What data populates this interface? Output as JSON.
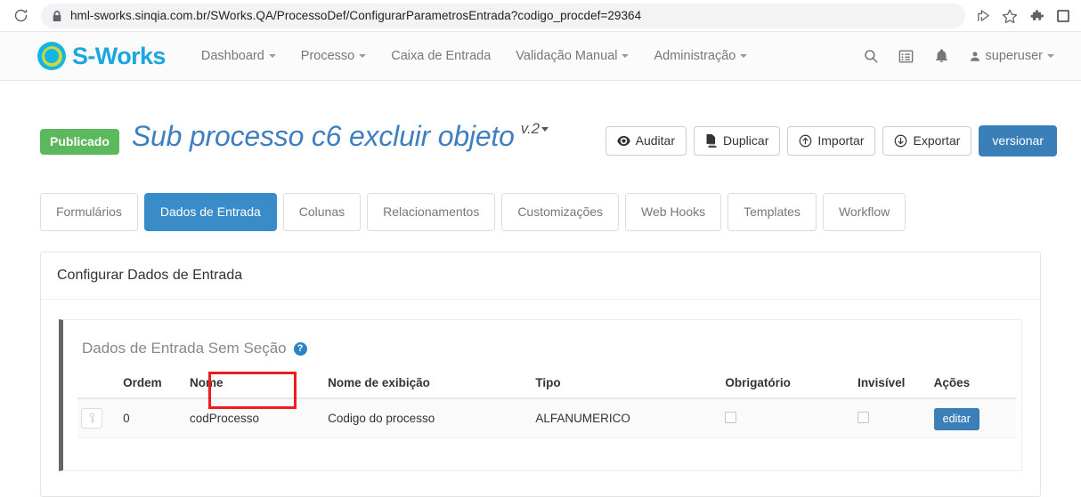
{
  "browser": {
    "url": "hml-sworks.sinqia.com.br/SWorks.QA/ProcessoDef/ConfigurarParametrosEntrada?codigo_procdef=29364",
    "reload_icon": "reload-icon",
    "lock_icon": "lock-icon",
    "toolbar_icons": [
      "share-icon",
      "star-icon",
      "extensions-puzzle-icon",
      "profile-square-icon"
    ]
  },
  "navbar": {
    "brand": "S-Works",
    "items": [
      {
        "label": "Dashboard",
        "has_caret": true
      },
      {
        "label": "Processo",
        "has_caret": true
      },
      {
        "label": "Caixa de Entrada",
        "has_caret": false
      },
      {
        "label": "Validação Manual",
        "has_caret": true
      },
      {
        "label": "Administração",
        "has_caret": true
      }
    ],
    "right_icons": [
      "search-icon",
      "list-icon",
      "bell-icon"
    ],
    "user": "superuser"
  },
  "header": {
    "status_badge": "Publicado",
    "title": "Sub processo c6 excluir objeto",
    "version": "v.2",
    "actions": [
      {
        "label": "Auditar",
        "icon": "eye-icon"
      },
      {
        "label": "Duplicar",
        "icon": "copy-icon"
      },
      {
        "label": "Importar",
        "icon": "arrow-up-circle-icon"
      },
      {
        "label": "Exportar",
        "icon": "arrow-down-circle-icon"
      }
    ],
    "primary_action": "versionar"
  },
  "tabs": [
    {
      "label": "Formulários",
      "active": false
    },
    {
      "label": "Dados de Entrada",
      "active": true
    },
    {
      "label": "Colunas",
      "active": false
    },
    {
      "label": "Relacionamentos",
      "active": false
    },
    {
      "label": "Customizações",
      "active": false
    },
    {
      "label": "Web Hooks",
      "active": false
    },
    {
      "label": "Templates",
      "active": false
    },
    {
      "label": "Workflow",
      "active": false
    }
  ],
  "panel": {
    "title": "Configurar Dados de Entrada",
    "section_title": "Dados de Entrada Sem Seção",
    "help_icon_label": "?"
  },
  "table": {
    "headers": [
      "Ordem",
      "Nome",
      "Nome de exibição",
      "Tipo",
      "Obrigatório",
      "Invisível",
      "Ações"
    ],
    "rows": [
      {
        "handle_icon": "key-icon",
        "ordem": "0",
        "nome": "codProcesso",
        "nome_exibicao": "Codigo do processo",
        "tipo": "ALFANUMERICO",
        "obrigatorio": false,
        "invisivel": false,
        "action_label": "editar"
      }
    ]
  },
  "annotation": {
    "target": "codProcesso",
    "color": "#ee1c1c"
  },
  "colors": {
    "primary_blue": "#3a7fb8",
    "tab_active_blue": "#3a8cc8",
    "badge_green": "#5cb85c",
    "title_blue": "#3f7fc1",
    "brand_cyan": "#14b4e4",
    "brand_lime": "#c9d93a",
    "annotation_red": "#ee1c1c"
  }
}
